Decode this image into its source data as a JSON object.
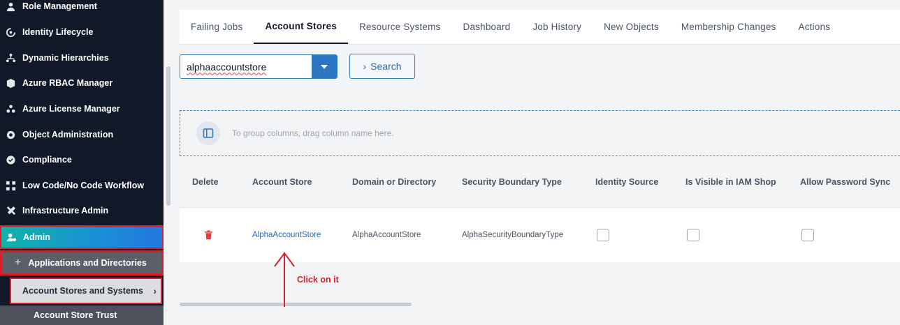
{
  "sidebar": {
    "items": [
      {
        "label": "Role Management",
        "icon": "user-badge-icon"
      },
      {
        "label": "Identity Lifecycle",
        "icon": "lifecycle-icon"
      },
      {
        "label": "Dynamic Hierarchies",
        "icon": "hierarchy-icon"
      },
      {
        "label": "Azure RBAC Manager",
        "icon": "cube-icon"
      },
      {
        "label": "Azure License Manager",
        "icon": "license-icon"
      },
      {
        "label": "Object Administration",
        "icon": "gear-icon"
      },
      {
        "label": "Compliance",
        "icon": "compliance-icon"
      },
      {
        "label": "Low Code/No Code Workflow",
        "icon": "workflow-icon"
      },
      {
        "label": "Infrastructure Admin",
        "icon": "tools-icon"
      }
    ],
    "admin": {
      "label": "Admin",
      "icon": "admin-gear-icon"
    },
    "applications": {
      "label": "Applications and Directories"
    },
    "account_stores": {
      "label": "Account Stores and Systems"
    },
    "account_store_trust": {
      "label": "Account Store Trust"
    }
  },
  "tabs": [
    {
      "label": "Failing Jobs",
      "active": false
    },
    {
      "label": "Account Stores",
      "active": true
    },
    {
      "label": "Resource Systems",
      "active": false
    },
    {
      "label": "Dashboard",
      "active": false
    },
    {
      "label": "Job History",
      "active": false
    },
    {
      "label": "New Objects",
      "active": false
    },
    {
      "label": "Membership Changes",
      "active": false
    },
    {
      "label": "Actions",
      "active": false
    }
  ],
  "search": {
    "selected_value": "alphaaccountstore",
    "button_label": "Search"
  },
  "grid": {
    "group_hint": "To group columns, drag column name here.",
    "columns": [
      "Delete",
      "Account Store",
      "Domain or Directory",
      "Security Boundary Type",
      "Identity Source",
      "Is Visible in IAM Shop",
      "Allow Password Sync"
    ],
    "rows": [
      {
        "account_store": "AlphaAccountStore",
        "domain": "AlphaAccountStore",
        "security_boundary_type": "AlphaSecurityBoundaryType",
        "identity_source": false,
        "visible_in_iam_shop": false,
        "allow_password_sync": false
      }
    ]
  },
  "annotation": {
    "text": "Click on it",
    "color": "#d9202a"
  },
  "colors": {
    "accent": "#2b77c4",
    "highlight": "#d9202a",
    "sidebar_bg": "#111827"
  }
}
